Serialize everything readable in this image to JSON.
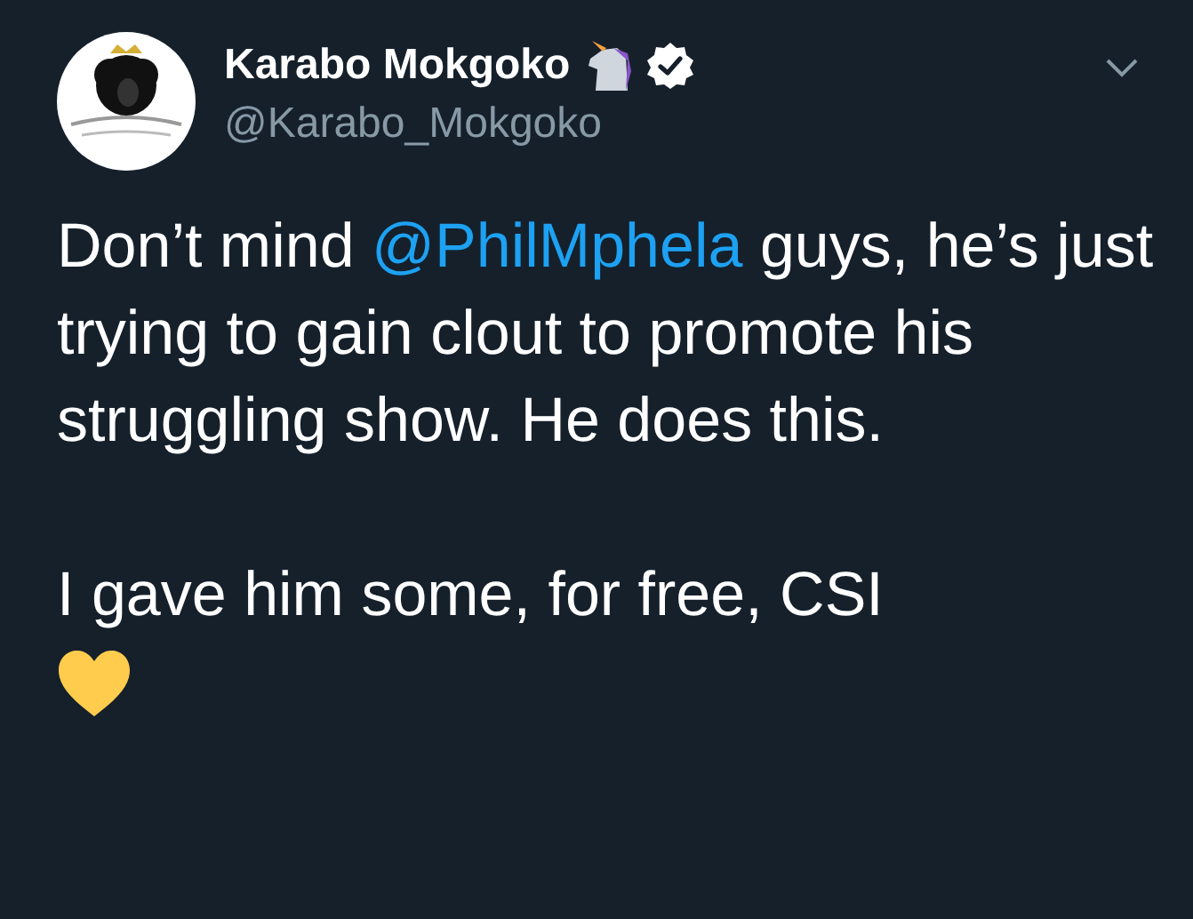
{
  "tweet": {
    "author": {
      "name": "Karabo Mokgoko",
      "handle": "@Karabo_Mokgoko",
      "verified": true
    },
    "paragraphs": [
      {
        "parts": [
          {
            "kind": "text",
            "text": "Don’t mind "
          },
          {
            "kind": "mention",
            "text": "@PhilMphela"
          },
          {
            "kind": "text",
            "text": " guys, he’s just trying to gain clout to promote his struggling show. He does this."
          }
        ]
      },
      {
        "parts": [
          {
            "kind": "text",
            "text": "I gave him some, for free, CSI"
          }
        ]
      }
    ]
  }
}
